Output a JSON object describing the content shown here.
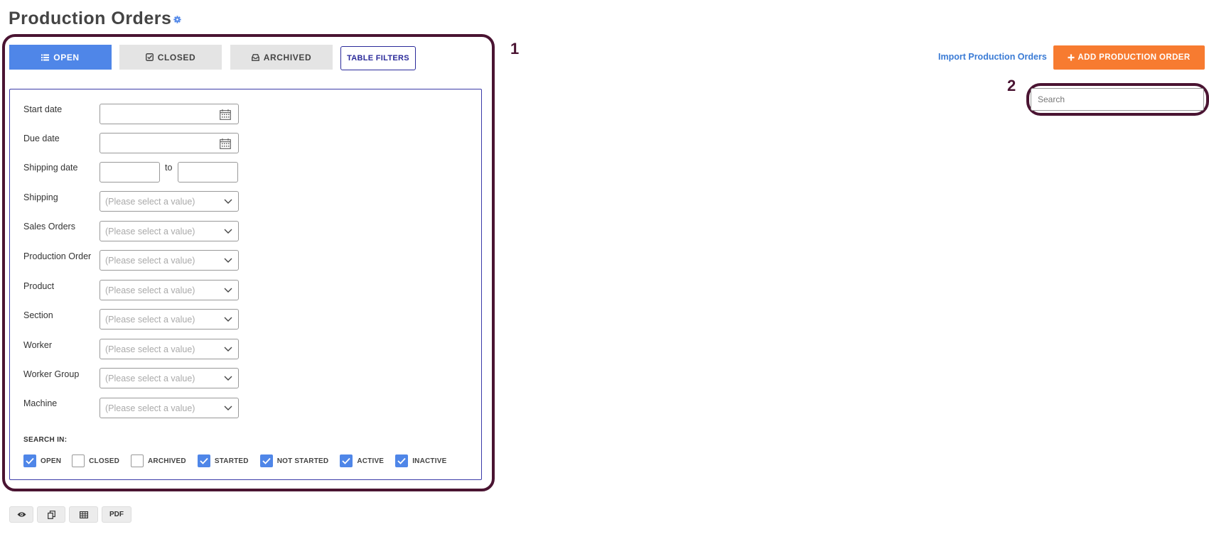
{
  "page": {
    "title": "Production Orders"
  },
  "tabs": {
    "open": "OPEN",
    "closed": "CLOSED",
    "archived": "ARCHIVED",
    "table_filters": "TABLE FILTERS"
  },
  "filters": {
    "start_date": {
      "label": "Start date",
      "value": ""
    },
    "due_date": {
      "label": "Due date",
      "value": ""
    },
    "shipping_date": {
      "label": "Shipping date",
      "to": "to",
      "from_value": "",
      "to_value": ""
    },
    "selects": [
      {
        "label": "Shipping",
        "value": "(Please select a value)"
      },
      {
        "label": "Sales Orders",
        "value": "(Please select a value)"
      },
      {
        "label": "Production Order",
        "value": "(Please select a value)"
      },
      {
        "label": "Product",
        "value": "(Please select a value)"
      },
      {
        "label": "Section",
        "value": "(Please select a value)"
      },
      {
        "label": "Worker",
        "value": "(Please select a value)"
      },
      {
        "label": "Worker Group",
        "value": "(Please select a value)"
      },
      {
        "label": "Machine",
        "value": "(Please select a value)"
      }
    ],
    "search_in_label": "SEARCH IN:",
    "search_in": [
      {
        "label": "OPEN",
        "checked": true
      },
      {
        "label": "CLOSED",
        "checked": false
      },
      {
        "label": "ARCHIVED",
        "checked": false
      },
      {
        "label": "STARTED",
        "checked": true
      },
      {
        "label": "NOT STARTED",
        "checked": true
      },
      {
        "label": "ACTIVE",
        "checked": true
      },
      {
        "label": "INACTIVE",
        "checked": true
      }
    ]
  },
  "header_actions": {
    "import": "Import Production Orders",
    "add": "ADD PRODUCTION ORDER"
  },
  "search": {
    "placeholder": "Search",
    "value": ""
  },
  "bottom_toolbar": {
    "pdf": "PDF"
  },
  "annotations": {
    "marker_1": "1",
    "marker_2": "2"
  },
  "colors": {
    "primary": "#4f86e8",
    "accent": "#f77b30",
    "highlight": "#4a1432",
    "filter_border": "#3a3aa8"
  }
}
